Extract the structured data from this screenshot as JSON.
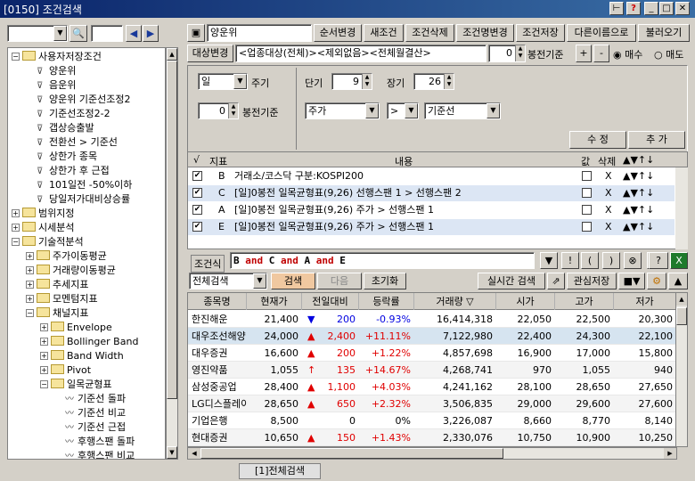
{
  "window": {
    "title": "[0150] 조건검색"
  },
  "sidebar": {
    "items": [
      {
        "label": "사용자저장조건",
        "level": 0,
        "exp": "−",
        "type": "folder"
      },
      {
        "label": "양운위",
        "level": 1,
        "type": "filter"
      },
      {
        "label": "음운위",
        "level": 1,
        "type": "filter"
      },
      {
        "label": "양운위 기준선조정2",
        "level": 1,
        "type": "filter"
      },
      {
        "label": "기준선조정2-2",
        "level": 1,
        "type": "filter"
      },
      {
        "label": "갭상승출발",
        "level": 1,
        "type": "filter"
      },
      {
        "label": "전환선 > 기준선",
        "level": 1,
        "type": "filter"
      },
      {
        "label": "상한가 종목",
        "level": 1,
        "type": "filter"
      },
      {
        "label": "상한가 후 근접",
        "level": 1,
        "type": "filter"
      },
      {
        "label": "101일전 -50%이하",
        "level": 1,
        "type": "filter"
      },
      {
        "label": "당일저가대비상승률",
        "level": 1,
        "type": "filter"
      },
      {
        "label": "범위지정",
        "level": 0,
        "exp": "+",
        "type": "folder"
      },
      {
        "label": "시세분석",
        "level": 0,
        "exp": "+",
        "type": "folder"
      },
      {
        "label": "기술적분석",
        "level": 0,
        "exp": "−",
        "type": "folder"
      },
      {
        "label": "주가이동평균",
        "level": 1,
        "exp": "+",
        "type": "folder"
      },
      {
        "label": "거래량이동평균",
        "level": 1,
        "exp": "+",
        "type": "folder"
      },
      {
        "label": "추세지표",
        "level": 1,
        "exp": "+",
        "type": "folder"
      },
      {
        "label": "모멘텀지표",
        "level": 1,
        "exp": "+",
        "type": "folder"
      },
      {
        "label": "채널지표",
        "level": 1,
        "exp": "−",
        "type": "folder"
      },
      {
        "label": "Envelope",
        "level": 2,
        "exp": "+",
        "type": "folder"
      },
      {
        "label": "Bollinger Band",
        "level": 2,
        "exp": "+",
        "type": "folder"
      },
      {
        "label": "Band Width",
        "level": 2,
        "exp": "+",
        "type": "folder"
      },
      {
        "label": "Pivot",
        "level": 2,
        "exp": "+",
        "type": "folder"
      },
      {
        "label": "일목균형표",
        "level": 2,
        "exp": "−",
        "type": "folder"
      },
      {
        "label": "기준선 돌파",
        "level": 3,
        "type": "chart"
      },
      {
        "label": "기준선 비교",
        "level": 3,
        "type": "chart"
      },
      {
        "label": "기준선 근접",
        "level": 3,
        "type": "chart"
      },
      {
        "label": "후행스팬 돌파",
        "level": 3,
        "type": "chart"
      },
      {
        "label": "후행스팬 비교",
        "level": 3,
        "type": "chart"
      },
      {
        "label": "후행",
        "level": 3,
        "type": "chart"
      }
    ]
  },
  "toolbar": {
    "name_value": "양운위",
    "btn_order": "순서변경",
    "btn_new": "새조건",
    "btn_delete": "조건삭제",
    "btn_rename": "조건명변경",
    "btn_save": "조건저장",
    "btn_save_as": "다른이름으로",
    "btn_load": "불러오기",
    "btn_target": "대상변경",
    "target_value": "<업종대상(전체)><제외없음><전체월결산>",
    "offset_value": "0",
    "offset_label": "봉전기준",
    "plus": "+",
    "minus": "-",
    "buy": "매수",
    "sell": "매도"
  },
  "params": {
    "period": "일",
    "period_label": "주기",
    "short_label": "단기",
    "short_value": "9",
    "long_label": "장기",
    "long_value": "26",
    "offset2_value": "0",
    "offset2_label": "봉전기준",
    "field1": "주가",
    "op": ">",
    "field2": "기준선",
    "btn_edit": "수 정",
    "btn_add": "추 가"
  },
  "conditions": {
    "headers": {
      "check": "√",
      "id": "지표",
      "content": "내용",
      "value": "값",
      "del": "삭제",
      "arrows": "▲▼↑↓"
    },
    "rows": [
      {
        "id": "B",
        "content": "거래소/코스닥 구분:KOSPI200",
        "del": "X",
        "arrows": "▲▼↑↓"
      },
      {
        "id": "C",
        "content": "[일]0봉전 일목균형표(9,26) 선행스팬 1 > 선행스팬 2",
        "del": "X",
        "arrows": "▲▼↑↓"
      },
      {
        "id": "A",
        "content": "[일]0봉전 일목균형표(9,26) 주가 > 선행스팬 1",
        "del": "X",
        "arrows": "▲▼↑↓"
      },
      {
        "id": "E",
        "content": "[일]0봉전 일목균형표(9,26) 주가 > 선행스팬 1",
        "del": "X",
        "arrows": "▲▼↑↓"
      }
    ]
  },
  "formula": {
    "label": "조건식",
    "value": "B and C and A and E",
    "ops": [
      "▼",
      "!",
      "(",
      ")",
      "⊗",
      "X",
      "?"
    ]
  },
  "search": {
    "scope": "전체검색",
    "btn_search": "검색",
    "btn_next": "다음",
    "btn_reset": "초기화",
    "btn_realtime": "실시간 검색",
    "btn_watchlist": "관심저장",
    "btn_more": "■"
  },
  "results": {
    "headers": [
      "종목명",
      "현재가",
      "전일대비",
      "등락률",
      "거래량 ▽",
      "시가",
      "고가",
      "저가"
    ],
    "rows": [
      {
        "name": "한진해운",
        "price": "21,400",
        "sign": "▼",
        "change": "200",
        "rate": "-0.93%",
        "volume": "16,414,318",
        "open": "22,050",
        "high": "22,500",
        "low": "20,300",
        "dir": "down"
      },
      {
        "name": "대우조선해양",
        "price": "24,000",
        "sign": "▲",
        "change": "2,400",
        "rate": "+11.11%",
        "volume": "7,122,980",
        "open": "22,400",
        "high": "24,300",
        "low": "22,100",
        "dir": "up"
      },
      {
        "name": "대우증권",
        "price": "16,600",
        "sign": "▲",
        "change": "200",
        "rate": "+1.22%",
        "volume": "4,857,698",
        "open": "16,900",
        "high": "17,000",
        "low": "15,800",
        "dir": "up"
      },
      {
        "name": "영진약품",
        "price": "1,055",
        "sign": "↑",
        "change": "135",
        "rate": "+14.67%",
        "volume": "4,268,741",
        "open": "970",
        "high": "1,055",
        "low": "940",
        "dir": "limit"
      },
      {
        "name": "삼성중공업",
        "price": "28,400",
        "sign": "▲",
        "change": "1,100",
        "rate": "+4.03%",
        "volume": "4,241,162",
        "open": "28,100",
        "high": "28,650",
        "low": "27,650",
        "dir": "up"
      },
      {
        "name": "LG디스플레이",
        "price": "28,650",
        "sign": "▲",
        "change": "650",
        "rate": "+2.32%",
        "volume": "3,506,835",
        "open": "29,000",
        "high": "29,600",
        "low": "27,600",
        "dir": "up"
      },
      {
        "name": "기업은행",
        "price": "8,500",
        "sign": "",
        "change": "0",
        "rate": "0%",
        "volume": "3,226,087",
        "open": "8,660",
        "high": "8,770",
        "low": "8,140",
        "dir": "flat"
      },
      {
        "name": "현대증권",
        "price": "10,650",
        "sign": "▲",
        "change": "150",
        "rate": "+1.43%",
        "volume": "2,330,076",
        "open": "10,750",
        "high": "10,900",
        "low": "10,250",
        "dir": "up"
      }
    ]
  },
  "bottom_tab": "[1]전체검색",
  "colors": {
    "title_bar": "#0a246a",
    "selected_row": "#d6e4f0",
    "up": "#e00000",
    "down": "#0000e0",
    "highlight_row": "#dce6f4"
  }
}
